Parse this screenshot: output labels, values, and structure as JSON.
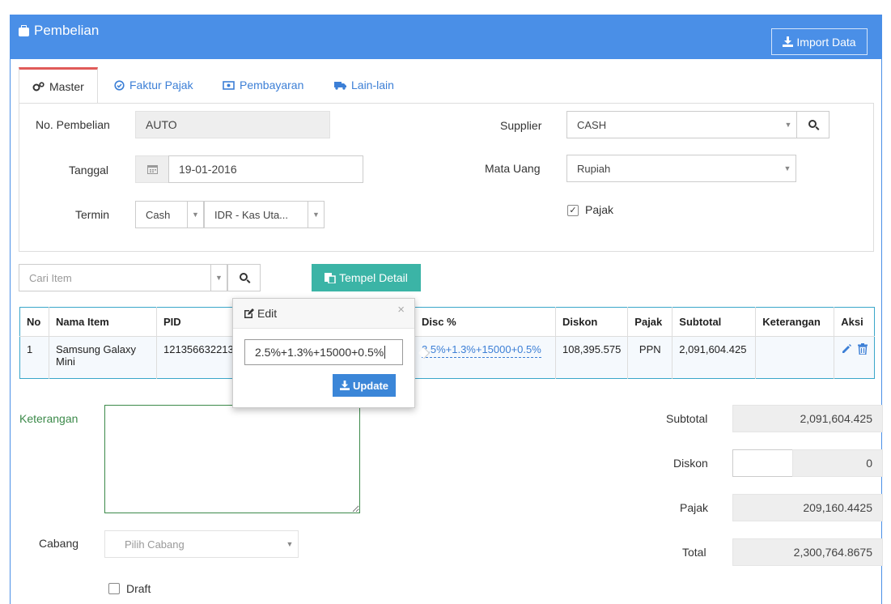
{
  "header": {
    "title": "Pembelian",
    "import_label": "Import Data"
  },
  "tabs": [
    {
      "label": "Master",
      "icon": "cogs-icon"
    },
    {
      "label": "Faktur Pajak",
      "icon": "check-circle-icon"
    },
    {
      "label": "Pembayaran",
      "icon": "money-icon"
    },
    {
      "label": "Lain-lain",
      "icon": "truck-icon"
    }
  ],
  "form": {
    "no_pembelian_label": "No. Pembelian",
    "no_pembelian_value": "AUTO",
    "tanggal_label": "Tanggal",
    "tanggal_value": "19-01-2016",
    "termin_label": "Termin",
    "termin_value": "Cash",
    "kas_value": "IDR - Kas Uta...",
    "supplier_label": "Supplier",
    "supplier_value": "CASH",
    "mata_uang_label": "Mata Uang",
    "mata_uang_value": "Rupiah",
    "pajak_label": "Pajak",
    "pajak_checked": "✓"
  },
  "item_search": {
    "placeholder": "Cari Item",
    "paste_label": "Tempel Detail"
  },
  "table": {
    "headers": [
      "No",
      "Nama Item",
      "PID",
      "Disc %",
      "Diskon",
      "Pajak",
      "Subtotal",
      "Keterangan",
      "Aksi"
    ],
    "rows": [
      {
        "no": "1",
        "nama": "Samsung Galaxy Mini",
        "pid": "121356632213",
        "disc": "2.5%+1.3%+15000+0.5%",
        "diskon": "108,395.575",
        "pajak": "PPN",
        "subtotal": "2,091,604.425",
        "keterangan": ""
      }
    ]
  },
  "popover": {
    "title": "Edit",
    "close": "×",
    "value": "2.5%+1.3%+15000+0.5%",
    "update_label": "Update"
  },
  "footer": {
    "keterangan_label": "Keterangan",
    "cabang_label": "Cabang",
    "cabang_placeholder": "Pilih Cabang",
    "draft_label": "Draft",
    "subtotal_label": "Subtotal",
    "subtotal_value": "2,091,604.425",
    "diskon_label": "Diskon",
    "diskon_value": "0",
    "pajak_label": "Pajak",
    "pajak_value": "209,160.4425",
    "total_label": "Total",
    "total_value": "2,300,764.8675"
  },
  "colors": {
    "primary": "#4a8fe7",
    "teal": "#3bb4a6",
    "active_tab": "#e05b59",
    "link": "#3c7fd6"
  }
}
